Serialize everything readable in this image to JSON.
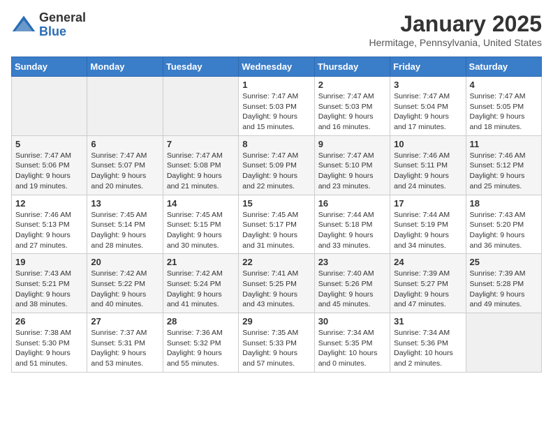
{
  "header": {
    "logo_general": "General",
    "logo_blue": "Blue",
    "month_title": "January 2025",
    "location": "Hermitage, Pennsylvania, United States"
  },
  "weekdays": [
    "Sunday",
    "Monday",
    "Tuesday",
    "Wednesday",
    "Thursday",
    "Friday",
    "Saturday"
  ],
  "weeks": [
    [
      {
        "day": "",
        "info": ""
      },
      {
        "day": "",
        "info": ""
      },
      {
        "day": "",
        "info": ""
      },
      {
        "day": "1",
        "info": "Sunrise: 7:47 AM\nSunset: 5:03 PM\nDaylight: 9 hours\nand 15 minutes."
      },
      {
        "day": "2",
        "info": "Sunrise: 7:47 AM\nSunset: 5:03 PM\nDaylight: 9 hours\nand 16 minutes."
      },
      {
        "day": "3",
        "info": "Sunrise: 7:47 AM\nSunset: 5:04 PM\nDaylight: 9 hours\nand 17 minutes."
      },
      {
        "day": "4",
        "info": "Sunrise: 7:47 AM\nSunset: 5:05 PM\nDaylight: 9 hours\nand 18 minutes."
      }
    ],
    [
      {
        "day": "5",
        "info": "Sunrise: 7:47 AM\nSunset: 5:06 PM\nDaylight: 9 hours\nand 19 minutes."
      },
      {
        "day": "6",
        "info": "Sunrise: 7:47 AM\nSunset: 5:07 PM\nDaylight: 9 hours\nand 20 minutes."
      },
      {
        "day": "7",
        "info": "Sunrise: 7:47 AM\nSunset: 5:08 PM\nDaylight: 9 hours\nand 21 minutes."
      },
      {
        "day": "8",
        "info": "Sunrise: 7:47 AM\nSunset: 5:09 PM\nDaylight: 9 hours\nand 22 minutes."
      },
      {
        "day": "9",
        "info": "Sunrise: 7:47 AM\nSunset: 5:10 PM\nDaylight: 9 hours\nand 23 minutes."
      },
      {
        "day": "10",
        "info": "Sunrise: 7:46 AM\nSunset: 5:11 PM\nDaylight: 9 hours\nand 24 minutes."
      },
      {
        "day": "11",
        "info": "Sunrise: 7:46 AM\nSunset: 5:12 PM\nDaylight: 9 hours\nand 25 minutes."
      }
    ],
    [
      {
        "day": "12",
        "info": "Sunrise: 7:46 AM\nSunset: 5:13 PM\nDaylight: 9 hours\nand 27 minutes."
      },
      {
        "day": "13",
        "info": "Sunrise: 7:45 AM\nSunset: 5:14 PM\nDaylight: 9 hours\nand 28 minutes."
      },
      {
        "day": "14",
        "info": "Sunrise: 7:45 AM\nSunset: 5:15 PM\nDaylight: 9 hours\nand 30 minutes."
      },
      {
        "day": "15",
        "info": "Sunrise: 7:45 AM\nSunset: 5:17 PM\nDaylight: 9 hours\nand 31 minutes."
      },
      {
        "day": "16",
        "info": "Sunrise: 7:44 AM\nSunset: 5:18 PM\nDaylight: 9 hours\nand 33 minutes."
      },
      {
        "day": "17",
        "info": "Sunrise: 7:44 AM\nSunset: 5:19 PM\nDaylight: 9 hours\nand 34 minutes."
      },
      {
        "day": "18",
        "info": "Sunrise: 7:43 AM\nSunset: 5:20 PM\nDaylight: 9 hours\nand 36 minutes."
      }
    ],
    [
      {
        "day": "19",
        "info": "Sunrise: 7:43 AM\nSunset: 5:21 PM\nDaylight: 9 hours\nand 38 minutes."
      },
      {
        "day": "20",
        "info": "Sunrise: 7:42 AM\nSunset: 5:22 PM\nDaylight: 9 hours\nand 40 minutes."
      },
      {
        "day": "21",
        "info": "Sunrise: 7:42 AM\nSunset: 5:24 PM\nDaylight: 9 hours\nand 41 minutes."
      },
      {
        "day": "22",
        "info": "Sunrise: 7:41 AM\nSunset: 5:25 PM\nDaylight: 9 hours\nand 43 minutes."
      },
      {
        "day": "23",
        "info": "Sunrise: 7:40 AM\nSunset: 5:26 PM\nDaylight: 9 hours\nand 45 minutes."
      },
      {
        "day": "24",
        "info": "Sunrise: 7:39 AM\nSunset: 5:27 PM\nDaylight: 9 hours\nand 47 minutes."
      },
      {
        "day": "25",
        "info": "Sunrise: 7:39 AM\nSunset: 5:28 PM\nDaylight: 9 hours\nand 49 minutes."
      }
    ],
    [
      {
        "day": "26",
        "info": "Sunrise: 7:38 AM\nSunset: 5:30 PM\nDaylight: 9 hours\nand 51 minutes."
      },
      {
        "day": "27",
        "info": "Sunrise: 7:37 AM\nSunset: 5:31 PM\nDaylight: 9 hours\nand 53 minutes."
      },
      {
        "day": "28",
        "info": "Sunrise: 7:36 AM\nSunset: 5:32 PM\nDaylight: 9 hours\nand 55 minutes."
      },
      {
        "day": "29",
        "info": "Sunrise: 7:35 AM\nSunset: 5:33 PM\nDaylight: 9 hours\nand 57 minutes."
      },
      {
        "day": "30",
        "info": "Sunrise: 7:34 AM\nSunset: 5:35 PM\nDaylight: 10 hours\nand 0 minutes."
      },
      {
        "day": "31",
        "info": "Sunrise: 7:34 AM\nSunset: 5:36 PM\nDaylight: 10 hours\nand 2 minutes."
      },
      {
        "day": "",
        "info": ""
      }
    ]
  ]
}
